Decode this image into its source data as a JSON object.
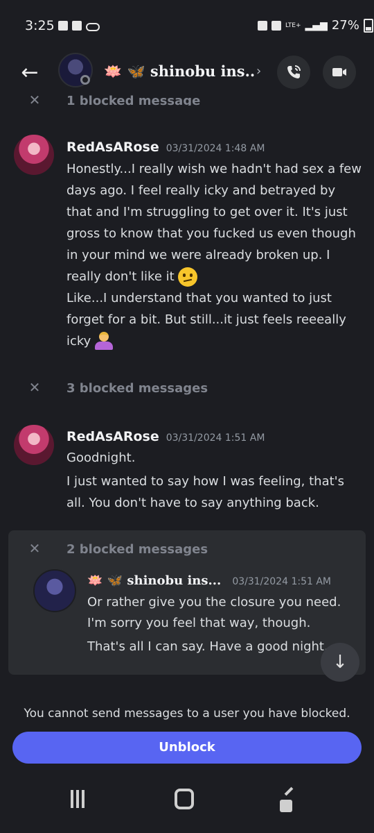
{
  "status_bar": {
    "time": "3:25",
    "network": "LTE+",
    "battery": "27%"
  },
  "header": {
    "contact_name": "🪷 🦋 shinobu ins..",
    "chevron": "›"
  },
  "messages": {
    "top_blocked": "1 blocked message",
    "group1": {
      "author": "RedAsARose",
      "timestamp": "03/31/2024 1:48 AM",
      "text1": "Honestly...I really wish we hadn't had sex a few days ago. I feel really icky and betrayed by that and I'm struggling to get over it. It's just gross to know that you fucked us even though in your mind we were already broken up. I really don't like it",
      "text2": "Like...I understand that you wanted to just forget for a bit. But still...it just feels reeeally icky"
    },
    "blocked2": "3 blocked messages",
    "group2": {
      "author": "RedAsARose",
      "timestamp": "03/31/2024 1:51 AM",
      "text1": "Goodnight.",
      "text2": "I just wanted to say how I was feeling, that's all. You don't have to say anything back."
    },
    "blocked3": "2 blocked messages",
    "group3": {
      "author": "🪷 🦋 shinobu ins...",
      "timestamp": "03/31/2024 1:51 AM",
      "text1": "Or rather give you the closure you need.",
      "text2": "I'm sorry you feel that way, though.",
      "text3": "That's all I can say. Have a good night."
    }
  },
  "composer": {
    "blocked_notice": "You cannot send messages to a user you have blocked.",
    "unblock_label": "Unblock"
  },
  "colors": {
    "background": "#1c1d22",
    "accent": "#5865f2",
    "muted": "#80848e"
  }
}
